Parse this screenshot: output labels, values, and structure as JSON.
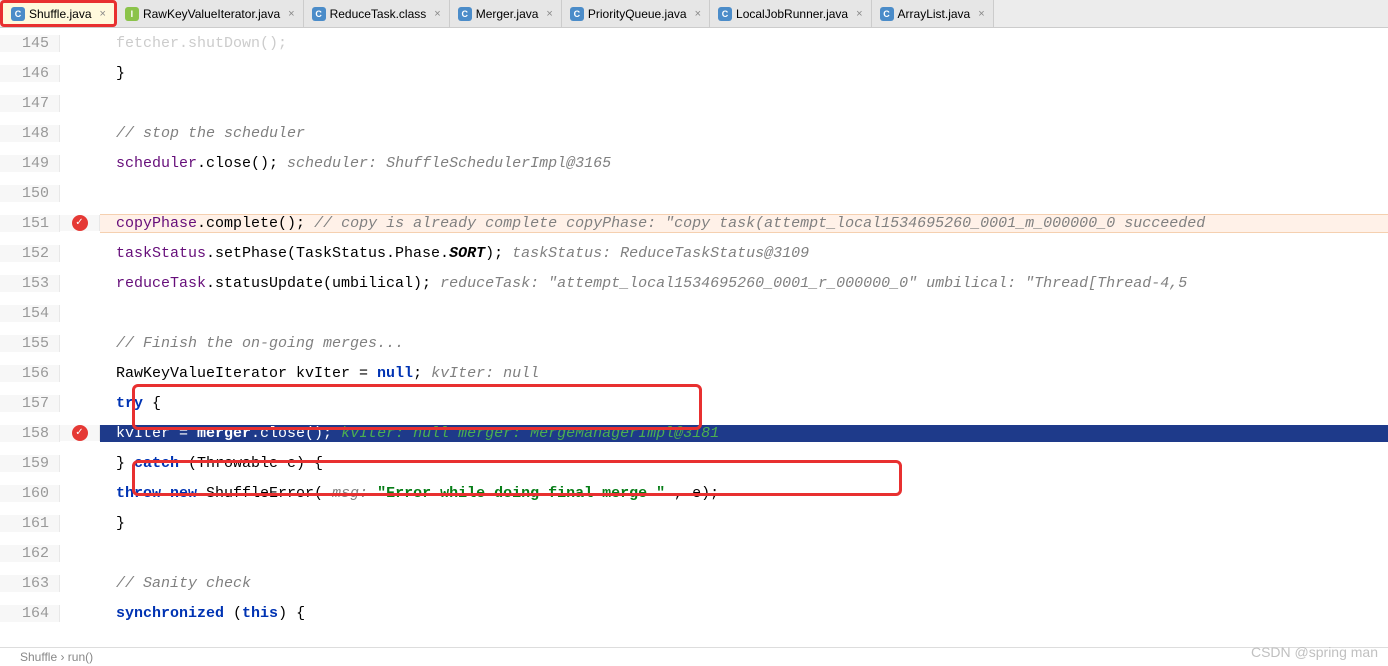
{
  "tabs": [
    {
      "label": "Shuffle.java",
      "icon": "C",
      "active": true
    },
    {
      "label": "RawKeyValueIterator.java",
      "icon": "I",
      "active": false
    },
    {
      "label": "ReduceTask.class",
      "icon": "C",
      "active": false
    },
    {
      "label": "Merger.java",
      "icon": "C",
      "active": false
    },
    {
      "label": "PriorityQueue.java",
      "icon": "C",
      "active": false
    },
    {
      "label": "LocalJobRunner.java",
      "icon": "C",
      "active": false
    },
    {
      "label": "ArrayList.java",
      "icon": "C",
      "active": false
    }
  ],
  "lines": {
    "l145_partial": "fetcher.shutDown();",
    "l146": "}",
    "l148_comment": "// stop the scheduler",
    "l149_code": "scheduler.close();",
    "l149_hint": "scheduler: ShuffleSchedulerImpl@3165",
    "l151_code": "copyPhase.complete();",
    "l151_hint": "// copy is already complete  copyPhase: \"copy task(attempt_local1534695260_0001_m_000000_0 succeeded",
    "l152_code_a": "taskStatus.setPhase(TaskStatus.Phase.",
    "l152_sort": "SORT",
    "l152_code_b": ");",
    "l152_hint": "taskStatus: ReduceTaskStatus@3109",
    "l153_code": "reduceTask.statusUpdate(umbilical);",
    "l153_hint": "reduceTask: \"attempt_local1534695260_0001_r_000000_0\"  umbilical: \"Thread[Thread-4,5",
    "l155_comment": "// Finish the on-going merges...",
    "l156_code_a": "RawKeyValueIterator kvIter = ",
    "l156_null": "null",
    "l156_code_b": ";",
    "l156_hint": "kvIter: null",
    "l157_try": "try",
    "l157_brace": " {",
    "l158_code_a": "kvIter = ",
    "l158_merger": "merger",
    "l158_code_b": ".close();",
    "l158_hint": "kvIter: null  merger: MergeManagerImpl@3181",
    "l159_code_a": "} ",
    "l159_catch": "catch",
    "l159_code_b": " (Throwable e) {",
    "l160_throw": "throw new",
    "l160_code_a": " ShuffleError(",
    "l160_msg": " msg: ",
    "l160_str": "\"Error while doing final merge \"",
    "l160_code_b": " , e);",
    "l161": "}",
    "l163_comment": "// Sanity check",
    "l164_sync": "synchronized",
    "l164_code": " (",
    "l164_this": "this",
    "l164_code_b": ") {"
  },
  "line_numbers": [
    "145",
    "146",
    "147",
    "148",
    "149",
    "150",
    "151",
    "152",
    "153",
    "154",
    "155",
    "156",
    "157",
    "158",
    "159",
    "160",
    "161",
    "162",
    "163",
    "164"
  ],
  "breadcrumb": "Shuffle  ›  run()",
  "watermark": "CSDN @spring man"
}
